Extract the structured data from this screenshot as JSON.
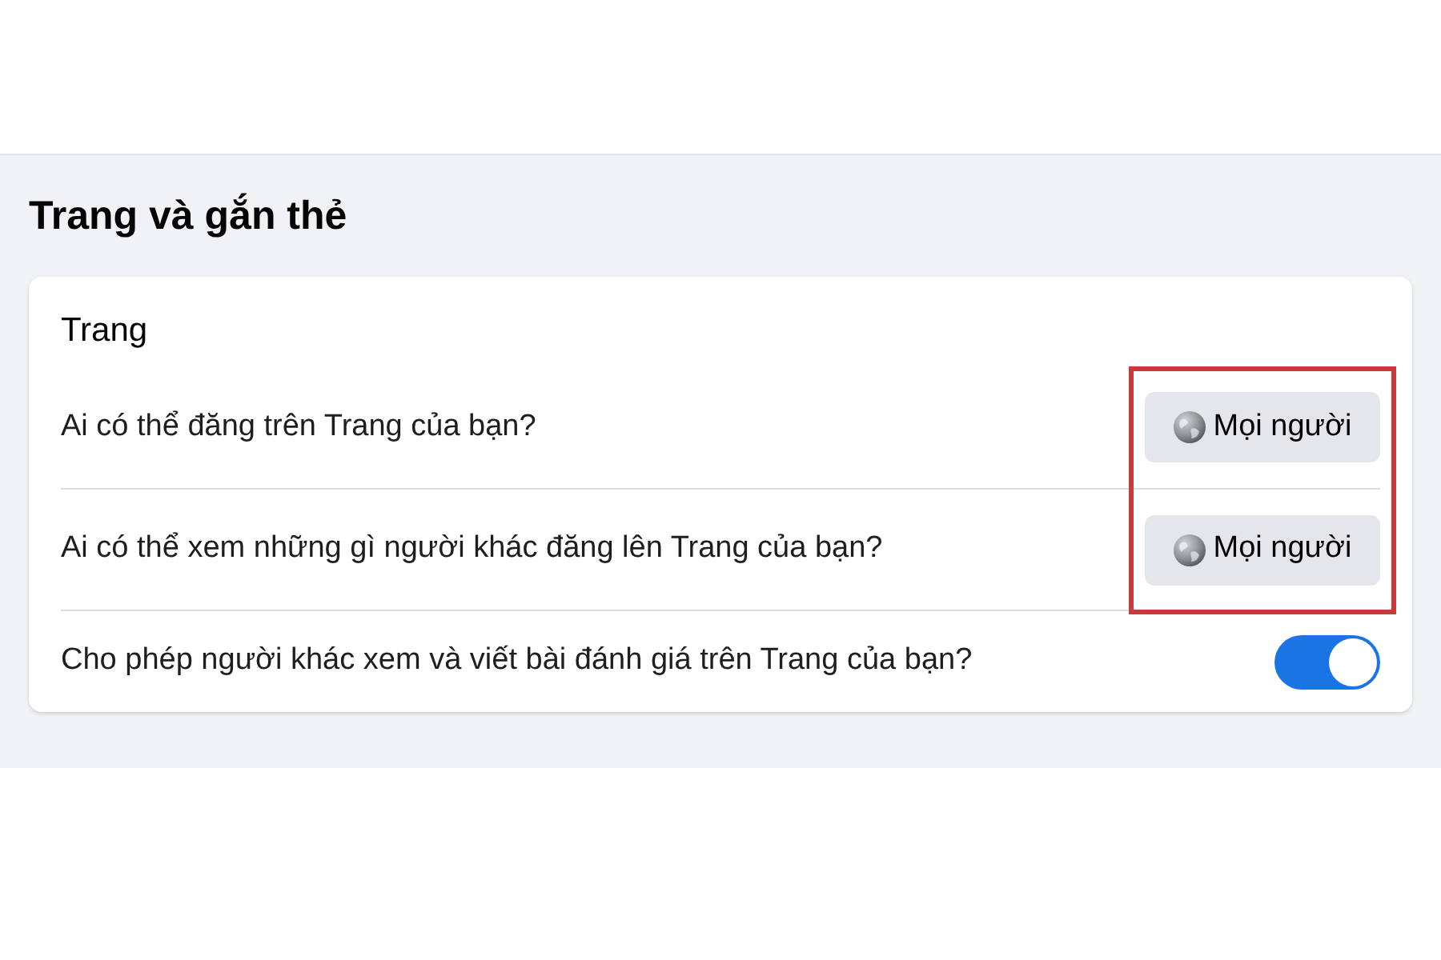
{
  "section": {
    "title": "Trang và gắn thẻ"
  },
  "card": {
    "heading": "Trang",
    "rows": [
      {
        "kind": "audience",
        "label": "Ai có thể đăng trên Trang của bạn?",
        "value": "Mọi người",
        "highlighted": true
      },
      {
        "kind": "audience",
        "label": "Ai có thể xem những gì người khác đăng lên Trang của bạn?",
        "value": "Mọi người",
        "highlighted": true
      },
      {
        "kind": "toggle",
        "label": "Cho phép người khác xem và viết bài đánh giá trên Trang của bạn?",
        "on": true,
        "highlighted": false
      }
    ]
  }
}
